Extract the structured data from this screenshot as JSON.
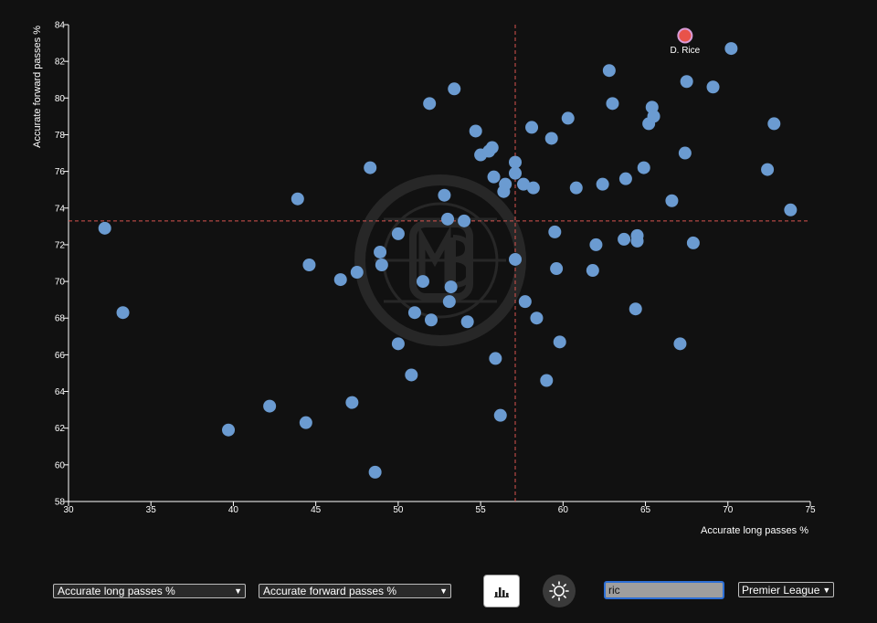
{
  "chart_data": {
    "type": "scatter",
    "xlabel": "Accurate long passes %",
    "ylabel": "Accurate forward passes %",
    "xlim": [
      30,
      75
    ],
    "ylim": [
      58,
      84
    ],
    "xticks": [
      30,
      35,
      40,
      45,
      50,
      55,
      60,
      65,
      70,
      75
    ],
    "yticks": [
      58,
      60,
      62,
      64,
      66,
      68,
      70,
      72,
      74,
      76,
      78,
      80,
      82,
      84
    ],
    "xtick_labels": [
      "30",
      "35",
      "40",
      "45",
      "50",
      "55",
      "60",
      "65",
      "70",
      "75"
    ],
    "ytick_labels": [
      "58",
      "60",
      "62",
      "64",
      "66",
      "68",
      "70",
      "72",
      "74",
      "76",
      "78",
      "80",
      "82",
      "84"
    ],
    "reference_lines": {
      "x": 57.1,
      "y": 73.3
    },
    "grid": false,
    "point_color": "#6b9bd1",
    "highlight_color": "#e8534a",
    "highlight_ring_color": "#d99bd8",
    "reference_color": "#d9534f",
    "highlight": {
      "label": "D. Rice",
      "x": 67.4,
      "y": 83.4
    },
    "points": [
      [
        32.2,
        72.9
      ],
      [
        33.3,
        68.3
      ],
      [
        39.7,
        61.9
      ],
      [
        42.2,
        63.2
      ],
      [
        43.9,
        74.5
      ],
      [
        44.4,
        62.3
      ],
      [
        44.6,
        70.9
      ],
      [
        46.5,
        70.1
      ],
      [
        47.2,
        63.4
      ],
      [
        47.5,
        70.5
      ],
      [
        48.3,
        76.2
      ],
      [
        48.6,
        59.6
      ],
      [
        48.9,
        71.6
      ],
      [
        49.0,
        70.9
      ],
      [
        50.0,
        72.6
      ],
      [
        50.0,
        66.6
      ],
      [
        50.8,
        64.9
      ],
      [
        51.0,
        68.3
      ],
      [
        51.5,
        70.0
      ],
      [
        51.9,
        79.7
      ],
      [
        52.0,
        67.9
      ],
      [
        52.8,
        74.7
      ],
      [
        53.0,
        73.4
      ],
      [
        53.1,
        68.9
      ],
      [
        53.2,
        69.7
      ],
      [
        53.4,
        80.5
      ],
      [
        54.0,
        73.3
      ],
      [
        54.2,
        67.8
      ],
      [
        54.7,
        78.2
      ],
      [
        55.0,
        76.9
      ],
      [
        55.5,
        77.1
      ],
      [
        55.7,
        77.3
      ],
      [
        55.8,
        75.7
      ],
      [
        55.9,
        65.8
      ],
      [
        56.2,
        62.7
      ],
      [
        56.4,
        74.9
      ],
      [
        56.5,
        75.3
      ],
      [
        57.1,
        76.5
      ],
      [
        57.1,
        75.9
      ],
      [
        57.1,
        71.2
      ],
      [
        57.6,
        75.3
      ],
      [
        57.7,
        68.9
      ],
      [
        58.1,
        78.4
      ],
      [
        58.2,
        75.1
      ],
      [
        58.4,
        68.0
      ],
      [
        59.0,
        64.6
      ],
      [
        59.3,
        77.8
      ],
      [
        59.5,
        72.7
      ],
      [
        59.6,
        70.7
      ],
      [
        59.8,
        66.7
      ],
      [
        60.3,
        78.9
      ],
      [
        60.8,
        75.1
      ],
      [
        61.8,
        70.6
      ],
      [
        62.0,
        72.0
      ],
      [
        62.4,
        75.3
      ],
      [
        62.8,
        81.5
      ],
      [
        63.0,
        79.7
      ],
      [
        63.7,
        72.3
      ],
      [
        63.8,
        75.6
      ],
      [
        64.4,
        68.5
      ],
      [
        64.5,
        72.5
      ],
      [
        64.5,
        72.2
      ],
      [
        64.9,
        76.2
      ],
      [
        65.2,
        78.6
      ],
      [
        65.4,
        79.5
      ],
      [
        65.5,
        79.0
      ],
      [
        66.6,
        74.4
      ],
      [
        67.1,
        66.6
      ],
      [
        67.4,
        77.0
      ],
      [
        67.5,
        80.9
      ],
      [
        67.9,
        72.1
      ],
      [
        69.1,
        80.6
      ],
      [
        70.2,
        82.7
      ],
      [
        72.4,
        76.1
      ],
      [
        72.8,
        78.6
      ],
      [
        73.8,
        73.9
      ]
    ]
  },
  "controls": {
    "x_metric": "Accurate long passes %",
    "y_metric": "Accurate forward passes %",
    "search_value": "ric",
    "league": "Premier League",
    "chart_icon": "bar-chart-icon",
    "theme_icon": "sun-icon"
  }
}
